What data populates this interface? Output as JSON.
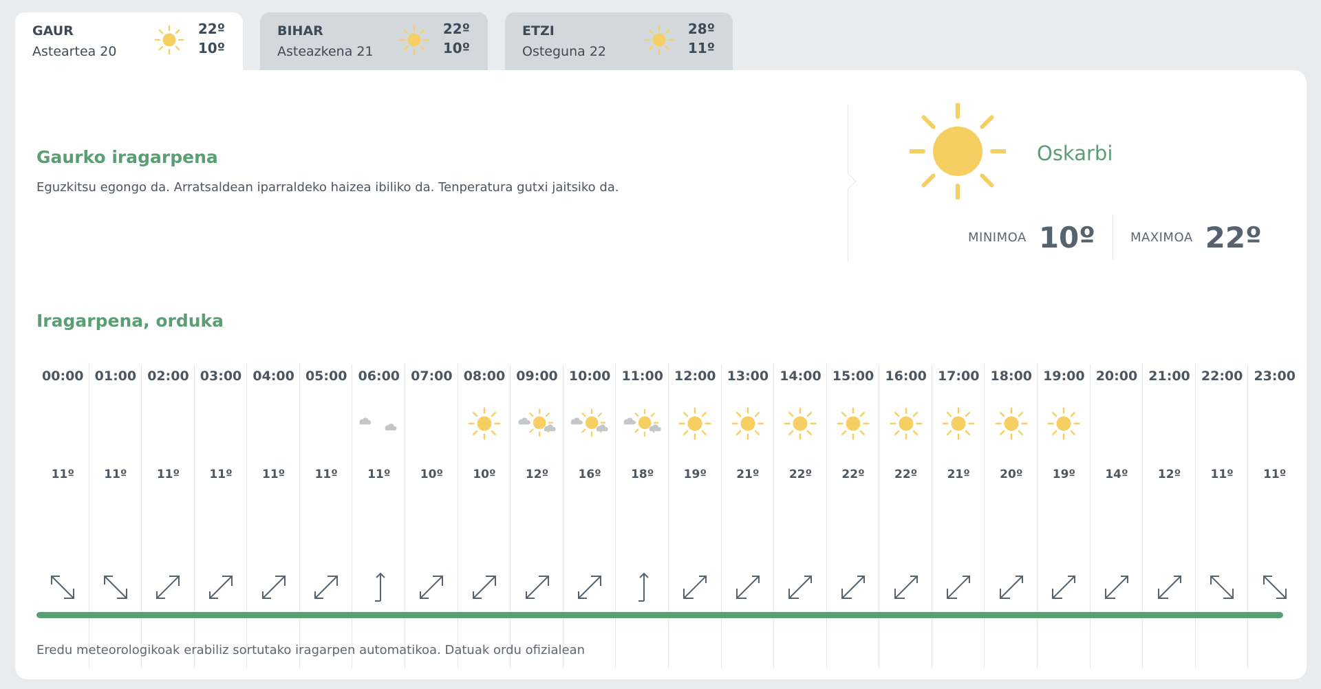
{
  "tabs": [
    {
      "name": "GAUR",
      "date": "Asteartea 20",
      "hi": "22º",
      "lo": "10º",
      "icon": "sun-icon",
      "active": true
    },
    {
      "name": "BIHAR",
      "date": "Asteazkena 21",
      "hi": "22º",
      "lo": "10º",
      "icon": "sun-icon",
      "active": false
    },
    {
      "name": "ETZI",
      "date": "Osteguna 22",
      "hi": "28º",
      "lo": "11º",
      "icon": "sun-icon",
      "active": false
    }
  ],
  "today": {
    "title": "Gaurko iragarpena",
    "text": "Eguzkitsu egongo da. Arratsaldean iparraldeko haizea ibiliko da. Tenperatura gutxi jaitsiko da.",
    "condition": "Oskarbi",
    "min_label": "MINIMOA",
    "min_value": "10º",
    "max_label": "MAXIMOA",
    "max_value": "22º",
    "icon": "sun-icon"
  },
  "hourly": {
    "title": "Iragarpena, orduka",
    "hours": [
      {
        "time": "00:00",
        "temp": "11º",
        "icon": "moon-icon",
        "wind": "nw"
      },
      {
        "time": "01:00",
        "temp": "11º",
        "icon": "moon-icon",
        "wind": "nw"
      },
      {
        "time": "02:00",
        "temp": "11º",
        "icon": "moon-icon",
        "wind": "sw"
      },
      {
        "time": "03:00",
        "temp": "11º",
        "icon": "moon-icon",
        "wind": "sw"
      },
      {
        "time": "04:00",
        "temp": "11º",
        "icon": "moon-icon",
        "wind": "sw"
      },
      {
        "time": "05:00",
        "temp": "11º",
        "icon": "moon-icon",
        "wind": "sw"
      },
      {
        "time": "06:00",
        "temp": "11º",
        "icon": "moon-cloud-icon",
        "wind": "s"
      },
      {
        "time": "07:00",
        "temp": "10º",
        "icon": "moon-icon",
        "wind": "sw"
      },
      {
        "time": "08:00",
        "temp": "10º",
        "icon": "sun-icon",
        "wind": "sw"
      },
      {
        "time": "09:00",
        "temp": "12º",
        "icon": "sun-cloud-icon",
        "wind": "sw"
      },
      {
        "time": "10:00",
        "temp": "16º",
        "icon": "sun-cloud-icon",
        "wind": "sw"
      },
      {
        "time": "11:00",
        "temp": "18º",
        "icon": "sun-cloud-icon",
        "wind": "s"
      },
      {
        "time": "12:00",
        "temp": "19º",
        "icon": "sun-icon",
        "wind": "ne"
      },
      {
        "time": "13:00",
        "temp": "21º",
        "icon": "sun-icon",
        "wind": "ne"
      },
      {
        "time": "14:00",
        "temp": "22º",
        "icon": "sun-icon",
        "wind": "ne"
      },
      {
        "time": "15:00",
        "temp": "22º",
        "icon": "sun-icon",
        "wind": "ne"
      },
      {
        "time": "16:00",
        "temp": "22º",
        "icon": "sun-icon",
        "wind": "ne"
      },
      {
        "time": "17:00",
        "temp": "21º",
        "icon": "sun-icon",
        "wind": "ne"
      },
      {
        "time": "18:00",
        "temp": "20º",
        "icon": "sun-icon",
        "wind": "ne"
      },
      {
        "time": "19:00",
        "temp": "19º",
        "icon": "sun-icon",
        "wind": "ne"
      },
      {
        "time": "20:00",
        "temp": "14º",
        "icon": "moon-icon",
        "wind": "ne"
      },
      {
        "time": "21:00",
        "temp": "12º",
        "icon": "moon-icon",
        "wind": "ne"
      },
      {
        "time": "22:00",
        "temp": "11º",
        "icon": "moon-icon",
        "wind": "nw"
      },
      {
        "time": "23:00",
        "temp": "11º",
        "icon": "moon-icon",
        "wind": "nw"
      }
    ],
    "scroll_progress": 1.0
  },
  "footnote": "Eredu meteorologikoak erabiliz sortutako iragarpen automatikoa. Datuak ordu ofizialean",
  "colors": {
    "accent": "#5a9e73",
    "sun": "#f6cf62",
    "moon": "#b9c9d6",
    "cloud": "#c4c7ca"
  }
}
